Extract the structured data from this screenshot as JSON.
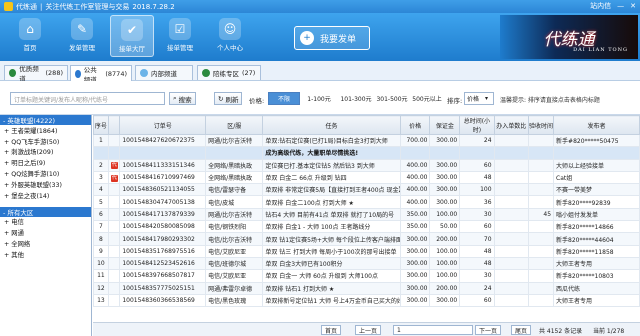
{
  "titlebar": {
    "app": "代练通",
    "sep": "|",
    "title": "关注代练工作室管理与交易",
    "version": "2018.7.28.2",
    "inbox": "站内信",
    "min": "—",
    "close": "✕"
  },
  "nav": [
    {
      "label": "首页",
      "icon": "home"
    },
    {
      "label": "发单管理",
      "icon": "send"
    },
    {
      "label": "接单大厅",
      "icon": "hall"
    },
    {
      "label": "接单管理",
      "icon": "manage"
    },
    {
      "label": "个人中心",
      "icon": "user"
    }
  ],
  "send_button": "我要发单",
  "brand": {
    "cn": "代练通",
    "en": "DAI LIAN TONG"
  },
  "tabs": [
    {
      "label": "优质频道",
      "count": "(288)"
    },
    {
      "label": "公共频道",
      "count": "(8774)"
    },
    {
      "label": "内部频道",
      "count": ""
    },
    {
      "label": "陪练专区",
      "count": "(27)"
    }
  ],
  "search": {
    "placeholder": "订单标题关键词/发布人昵称/代练号",
    "search_btn": "搜索",
    "refresh_btn": "刷新",
    "price_label": "价格:",
    "ranges": [
      "不限",
      "1-100元",
      "101-300元",
      "301-500元",
      "500元以上"
    ],
    "sort_label": "排序:",
    "sort_value": "价格",
    "tip": "温馨提示: 排序请直接点击表格内标题"
  },
  "sidebar": {
    "groups": [
      {
        "title": "- 英雄联盟(4222)",
        "items": [
          "+ 王者荣耀(1864)",
          "+ QQ飞车手游(50)",
          "+ 刺激战场(209)",
          "+ 明日之后(9)",
          "+ QQ炫舞手游(10)",
          "+ 外服英雄联盟(33)",
          "+ 堡垒之夜(14)"
        ]
      },
      {
        "title": "- 所有大区",
        "items": [
          "+ 电信",
          "+ 网通",
          "+ 全网络",
          "+ 其他"
        ]
      }
    ]
  },
  "table": {
    "headers": [
      "序号",
      "",
      "订单号",
      "区/服",
      "任务",
      "价格",
      "保证金",
      "总时间(小时)",
      "办入单数比",
      "验收时间",
      "发布者"
    ],
    "rows": [
      {
        "no": "1",
        "flag": "",
        "order": "1001548427620672375",
        "server": "网通/比尔吉沃特",
        "task": "单双:钻石定位赛(已打1局)目标白金3打到大师",
        "price": "700.00",
        "deposit": "300.00",
        "hours": "24",
        "ratio": "",
        "check": "",
        "pub": "新手#820*****50475"
      },
      {
        "no": "",
        "flag": "",
        "order": "",
        "server": "",
        "task": "成为高级代练，大量职单尽情挑选!",
        "price": "",
        "deposit": "",
        "hours": "",
        "ratio": "",
        "check": "",
        "pub": ""
      },
      {
        "no": "2",
        "flag": "代",
        "order": "1001548411333151346",
        "server": "全网络/黑暗执政",
        "task": "定位赛已打.基本定位钻5 然后钻3 到大师",
        "price": "400.00",
        "deposit": "300.00",
        "hours": "60",
        "ratio": "",
        "check": "",
        "pub": "大师以上经验接单"
      },
      {
        "no": "3",
        "flag": "代",
        "order": "1001548416710997469",
        "server": "全网络/黑暗执政",
        "task": "单双 白金二 66点 升级到 钻四",
        "price": "400.00",
        "deposit": "300.00",
        "hours": "48",
        "ratio": "",
        "check": "",
        "pub": "Cat姐"
      },
      {
        "no": "4",
        "flag": "",
        "order": "1001548360521134055",
        "server": "电信/雷瑟守备",
        "task": "单双排 非常定位赛5局【直接打到王者400点 现金】",
        "price": "400.00",
        "deposit": "300.00",
        "hours": "100",
        "ratio": "",
        "check": "",
        "pub": "不赛一带美梦"
      },
      {
        "no": "5",
        "flag": "",
        "order": "1001548304747005138",
        "server": "电信/皮城",
        "task": "单双排 白金二100点 打到大师 ★",
        "price": "400.00",
        "deposit": "300.00",
        "hours": "36",
        "ratio": "",
        "check": "",
        "pub": "新手820****92839"
      },
      {
        "no": "6",
        "flag": "",
        "order": "1001548417137879339",
        "server": "网通/比尔吉沃特",
        "task": "钻石4 大师 目前有41点 单双排 就打了10局的号",
        "price": "350.00",
        "deposit": "100.00",
        "hours": "30",
        "ratio": "",
        "check": "45",
        "pub": "嗡小姐付发发单"
      },
      {
        "no": "7",
        "flag": "",
        "order": "1001548420580085098",
        "server": "电信/钢铁烈阳",
        "task": "单双排 白金1 - 大师 100点 王者路线分",
        "price": "350.00",
        "deposit": "50.00",
        "hours": "60",
        "ratio": "",
        "check": "",
        "pub": "新手820*****14866"
      },
      {
        "no": "8",
        "flag": "",
        "order": "1001548417980293302",
        "server": "电信/比尔吉沃特",
        "task": "单双 钻1定位赛5场+大师 每个段位上传客户端排面截图",
        "price": "300.00",
        "deposit": "200.00",
        "hours": "70",
        "ratio": "",
        "check": "",
        "pub": "新手820*****44604"
      },
      {
        "no": "9",
        "flag": "",
        "order": "1001548351768975516",
        "server": "电信/艾欧尼亚",
        "task": "单双 钻三 打到大师 每周小于100次的那号出接单",
        "price": "300.00",
        "deposit": "100.00",
        "hours": "48",
        "ratio": "",
        "check": "",
        "pub": "新手820*****11858"
      },
      {
        "no": "10",
        "flag": "",
        "order": "1001548412523452616",
        "server": "电信/班德尔城",
        "task": "单双 白金3大师已有100积分",
        "price": "300.00",
        "deposit": "100.00",
        "hours": "48",
        "ratio": "",
        "check": "",
        "pub": "大师王者专用"
      },
      {
        "no": "11",
        "flag": "",
        "order": "1001548397668507817",
        "server": "电信/艾欧尼亚",
        "task": "单双 白金一 大师 60点 升级到 大师100点",
        "price": "300.00",
        "deposit": "100.00",
        "hours": "30",
        "ratio": "",
        "check": "",
        "pub": "新手820*****10803"
      },
      {
        "no": "12",
        "flag": "",
        "order": "1001548357775025151",
        "server": "网通/弗雷尔卓德",
        "task": "单双排 钻石1 打到大师 ★",
        "price": "300.00",
        "deposit": "200.00",
        "hours": "24",
        "ratio": "",
        "check": "",
        "pub": "西瓜代练"
      },
      {
        "no": "13",
        "flag": "",
        "order": "1001548360366538569",
        "server": "电信/黑色玫瑰",
        "task": "单双排新号定位钻1 大师 号上4万金币自己买大的好",
        "price": "300.00",
        "deposit": "300.00",
        "hours": "60",
        "ratio": "",
        "check": "",
        "pub": "大师王者专用"
      }
    ]
  },
  "pager": {
    "first": "首页",
    "prev": "上一页",
    "page": "1",
    "next": "下一页",
    "last": "尾页",
    "info": "共 4152 条记录",
    "pages": "当前 1/278"
  }
}
